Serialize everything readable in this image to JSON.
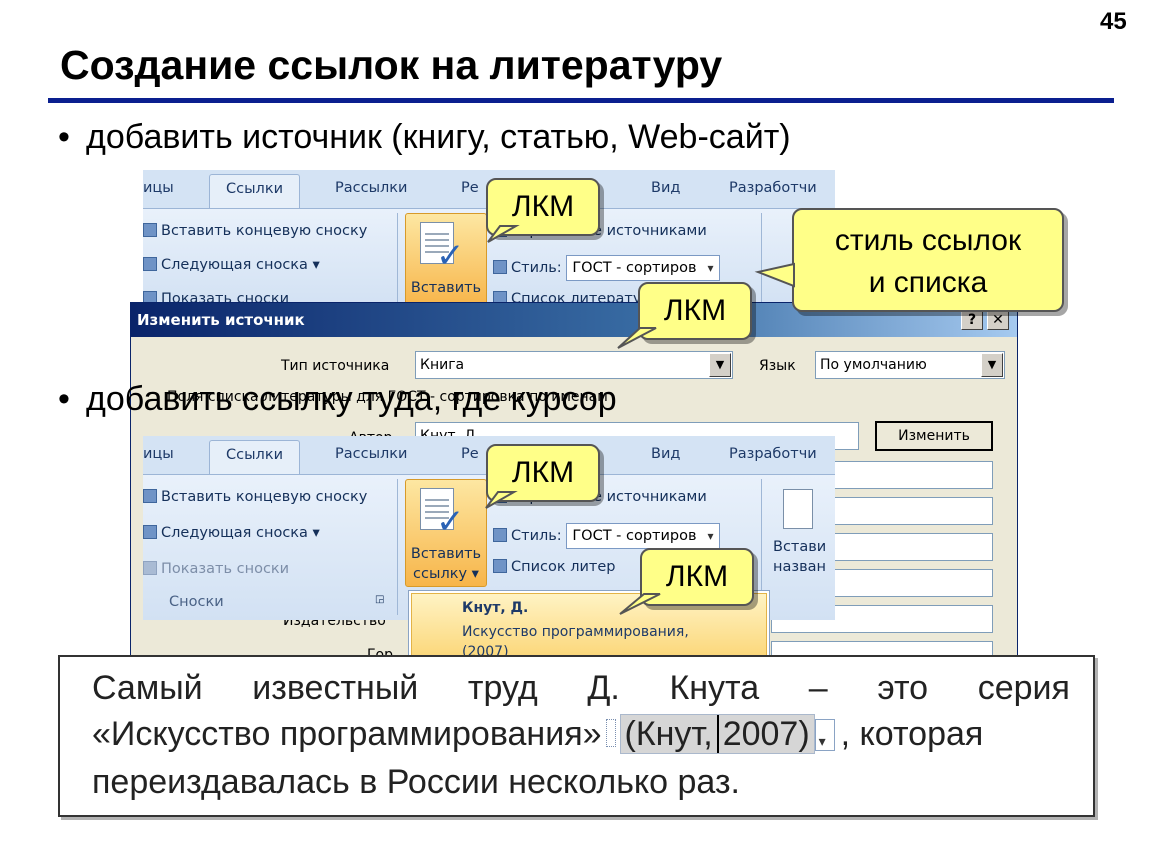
{
  "slide": {
    "number": "45",
    "title": "Создание ссылок на литературу",
    "bullets": [
      "добавить источник (книгу, статью, Web-сайт)",
      "добавить ссылку туда, где курсор"
    ]
  },
  "ribbon_top": {
    "tabs": [
      "ицы",
      "Ссылки",
      "Рассылки",
      "Ре",
      "Вид",
      "Разработчи"
    ],
    "footnotes": [
      "Вставить концевую сноску",
      "Следующая сноска ▾",
      "Показать сноски"
    ],
    "insert_label": "Вставить",
    "manage_sources": "Управление источниками",
    "style_label": "Стиль:",
    "style_value": "ГОСТ - сортиров",
    "bibliography": "Список литературы"
  },
  "ribbon_bottom": {
    "tabs": [
      "ицы",
      "Ссылки",
      "Рассылки",
      "Ре",
      "Вид",
      "Разработчи"
    ],
    "footnotes": [
      "Вставить концевую сноску",
      "Следующая сноска ▾",
      "Показать сноски"
    ],
    "group_label": "Сноски",
    "insert_label_1": "Вставить",
    "insert_label_2": "ссылку ▾",
    "manage_sources": "Управление источниками",
    "style_label": "Стиль:",
    "style_value": "ГОСТ - сортиров",
    "bibliography": "Список литер",
    "caption_1": "Встави",
    "caption_2": "назван"
  },
  "dialog": {
    "title": "Изменить источник",
    "help_btn": "?",
    "close_btn": "✕",
    "source_type_label": "Тип источника",
    "source_type_value": "Книга",
    "language_label": "Язык",
    "language_value": "По умолчанию",
    "fields_label": "Поля списка литературы для ГОСТ - сортировка по именам",
    "author_label": "Автор",
    "author_value": "Кнут, Д.",
    "edit_button": "Изменить",
    "publisher_label": "Издательство",
    "city_label": "Гор"
  },
  "dropdown": {
    "author": "Кнут, Д.",
    "work_title": "Искусство программирования,",
    "year": "(2007)"
  },
  "callouts": {
    "lkm": "ЛКМ",
    "style_note_1": "стиль ссылок",
    "style_note_2": "и списка"
  },
  "excerpt": {
    "line1": [
      "Самый",
      "известный",
      "труд",
      "Д.",
      "Кнута",
      "–",
      "это",
      "серия"
    ],
    "line2_before": "«Искусство программирования»",
    "citation_open": "(Кнут,",
    "citation_close": "2007)",
    "line2_after": ", которая",
    "line3": "переиздавалась в России несколько раз."
  },
  "colors": {
    "title_rule": "#0a1f8f",
    "callout_bg": "#ffff88",
    "ribbon_bg": "#dce7f5",
    "dialog_title": "#0a246a"
  }
}
